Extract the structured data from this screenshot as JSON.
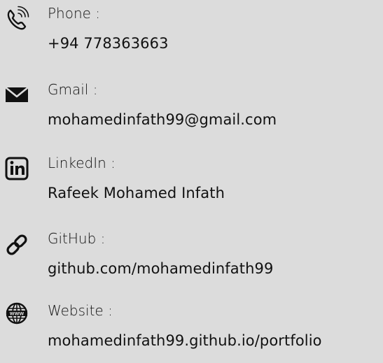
{
  "contacts": [
    {
      "icon": "phone-icon",
      "label": "Phone :",
      "value": "+94 778363663"
    },
    {
      "icon": "mail-icon",
      "label": "Gmail :",
      "value": "mohamedinfath99@gmail.com"
    },
    {
      "icon": "linkedin-icon",
      "label": "LinkedIn :",
      "value": "Rafeek Mohamed Infath"
    },
    {
      "icon": "link-icon",
      "label": "GitHub :",
      "value": "github.com/mohamedinfath99"
    },
    {
      "icon": "globe-icon",
      "label": "Website :",
      "value": "mohamedinfath99.github.io/portfolio"
    }
  ],
  "colors": {
    "background": "#dcdcdc",
    "text": "#111111"
  }
}
